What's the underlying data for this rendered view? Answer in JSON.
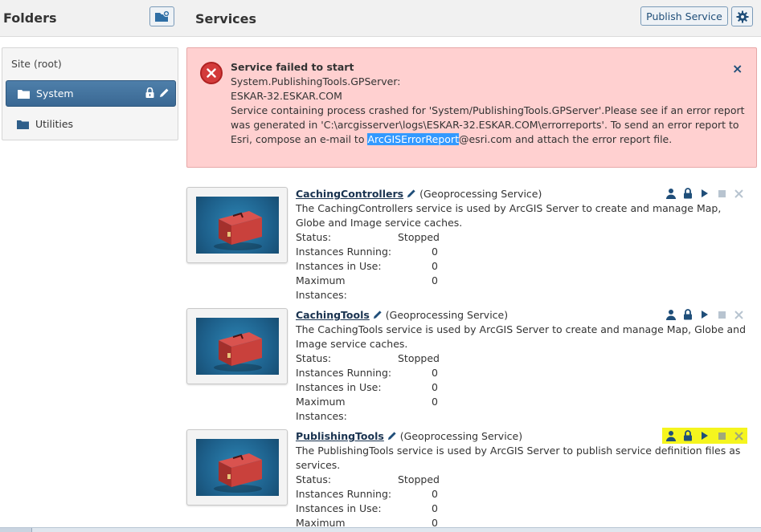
{
  "header": {
    "folders_title": "Folders",
    "services_title": "Services",
    "publish_label": "Publish Service"
  },
  "sidebar": {
    "root_label": "Site (root)",
    "items": [
      {
        "label": "System",
        "selected": true
      },
      {
        "label": "Utilities",
        "selected": false
      }
    ]
  },
  "error": {
    "title": "Service failed to start",
    "line1": "System.PublishingTools.GPServer:",
    "line2": "ESKAR-32.ESKAR.COM",
    "message_before": "Service containing process crashed for 'System/PublishingTools.GPServer'.Please see if an error report was generated in 'C:\\arcgisserver\\logs\\ESKAR-32.ESKAR.COM\\errorreports'. To send an error report to Esri, compose an e-mail to ",
    "email_highlight": "ArcGISErrorReport",
    "message_after": "@esri.com and attach the error report file.",
    "close_glyph": "×"
  },
  "services": [
    {
      "name": "CachingControllers",
      "type": "(Geoprocessing Service)",
      "description": "The CachingControllers service is used by ArcGIS Server to create and manage Map, Globe and Image service caches.",
      "status_label": "Status:",
      "status": "Stopped",
      "running_label": "Instances Running:",
      "running": "0",
      "in_use_label": "Instances in Use:",
      "in_use": "0",
      "max_label": "Maximum Instances:",
      "max": "0"
    },
    {
      "name": "CachingTools",
      "type": "(Geoprocessing Service)",
      "description": "The CachingTools service is used by ArcGIS Server to create and manage Map, Globe and Image service caches.",
      "status_label": "Status:",
      "status": "Stopped",
      "running_label": "Instances Running:",
      "running": "0",
      "in_use_label": "Instances in Use:",
      "in_use": "0",
      "max_label": "Maximum Instances:",
      "max": "0"
    },
    {
      "name": "PublishingTools",
      "type": "(Geoprocessing Service)",
      "description": "The PublishingTools service is used by ArcGIS Server to publish service definition files as services.",
      "status_label": "Status:",
      "status": "Stopped",
      "running_label": "Instances Running:",
      "running": "0",
      "in_use_label": "Instances in Use:",
      "in_use": "0",
      "max_label": "Maximum Instances:",
      "max": "0"
    }
  ],
  "icons": {
    "new_folder": "new-folder-icon",
    "settings": "gear-icon",
    "folder": "folder-icon",
    "lock": "lock-icon",
    "edit": "pencil-icon",
    "error": "error-x-icon",
    "permissions": "user-icon",
    "start": "play-icon",
    "stop": "stop-icon",
    "delete": "delete-x-icon"
  },
  "colors": {
    "accent": "#1f4e79",
    "selected_folder": "#3a6893",
    "error_bg": "#ffd0d0",
    "highlight": "#f5f51e"
  }
}
